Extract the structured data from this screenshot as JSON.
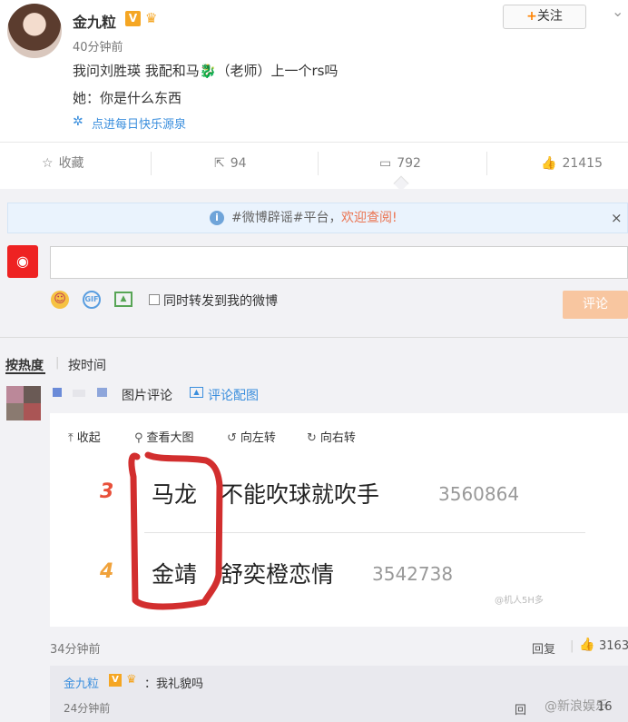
{
  "post": {
    "username": "金九粒",
    "v_badge": "V",
    "time": "40分钟前",
    "line1": "我问刘胜瑛 我配和马🐉（老师）上一个rs吗",
    "line2": "她：你是什么东西",
    "source": "点进每日快乐源泉",
    "follow_plus": "+",
    "follow_label": "关注",
    "menu_chevron": "⌄"
  },
  "actions": {
    "collect_label": "收藏",
    "repost_count": "94",
    "comment_count": "792",
    "like_count": "21415"
  },
  "notice": {
    "text": "#微博辟谣#平台，",
    "link": "欢迎查阅!",
    "close": "×"
  },
  "composer": {
    "forward_label": "同时转发到我的微博",
    "submit_label": "评论"
  },
  "sort": {
    "hot": "按热度",
    "separator": "|",
    "time": "按时间"
  },
  "comment": {
    "tag_pic": "图片评论",
    "tag_image": "评论配图",
    "time": "34分钟前",
    "reply": "回复",
    "like_count": "3163"
  },
  "viewer": {
    "collapse": "收起",
    "large": "查看大图",
    "rotate_left": "向左转",
    "rotate_right": "向右转",
    "rows": [
      {
        "rank": "3",
        "name": "马龙",
        "rest": "不能吹球就吹手",
        "count": "3560864"
      },
      {
        "rank": "4",
        "name": "金靖",
        "rest": "舒奕橙恋情",
        "count": "3542738"
      }
    ],
    "watermark": "@机人5H多",
    "rank_colors": [
      "#e8503a",
      "#f0a23b"
    ],
    "mark_color": "#d22e2e"
  },
  "reply": {
    "username": "金九粒",
    "v_badge": "V",
    "text": "：我礼貌吗",
    "time": "24分钟前",
    "reply": "回",
    "watermark": "@新浪娱乐",
    "count": "16"
  }
}
